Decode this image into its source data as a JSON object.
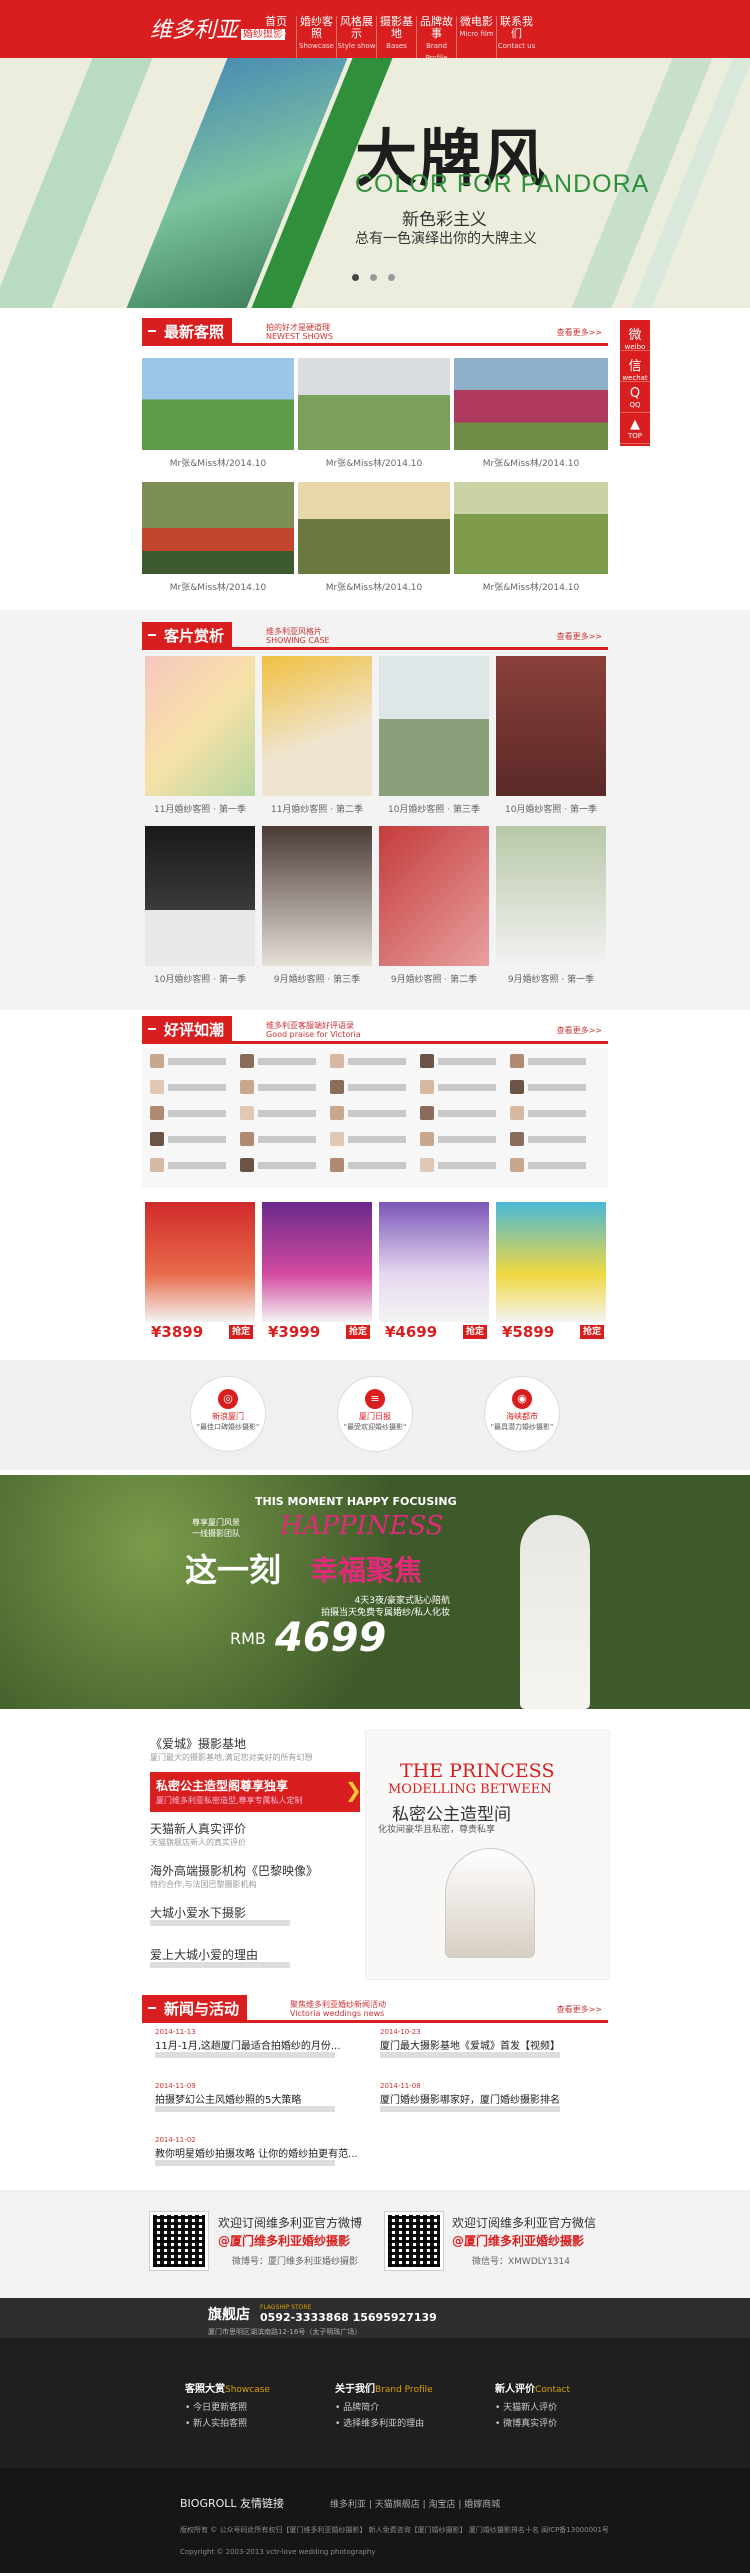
{
  "brand": {
    "logo": "维多利亚",
    "logo_tag": "婚纱摄影",
    "accent": "#d81e1e"
  },
  "nav": [
    {
      "zh": "首页",
      "en": "Home"
    },
    {
      "zh": "婚纱客照",
      "en": "Showcase"
    },
    {
      "zh": "风格展示",
      "en": "Style show"
    },
    {
      "zh": "摄影基地",
      "en": "Bases"
    },
    {
      "zh": "品牌故事",
      "en": "Brand Profile"
    },
    {
      "zh": "微电影",
      "en": "Micro film"
    },
    {
      "zh": "联系我们",
      "en": "Contact us"
    }
  ],
  "hero": {
    "title": "大牌风",
    "en": "COLOR FOR PANDORA",
    "sub1": "新色彩主义",
    "sub2": "总有一色演绎出你的大牌主义"
  },
  "sections": {
    "latest": {
      "title": "最新客照",
      "desc1": "拍的好才是硬道理",
      "desc2": "NEWEST SHOWS",
      "more": "查看更多>>"
    },
    "gallery": {
      "title": "客片赏析",
      "desc1": "维多利亚风格片",
      "desc2": "SHOWING CASE",
      "more": "查看更多>>"
    },
    "reviews": {
      "title": "好评如潮",
      "desc1": "维多利亚客服端好评语录",
      "desc2": "Good praise for Victoria",
      "more": "查看更多>>"
    },
    "news": {
      "title": "新闻与活动",
      "desc1": "聚焦维多利亚婚纱新闻活动",
      "desc2": "Victoria weddings news",
      "more": "查看更多>>"
    }
  },
  "latest_caps": [
    "Mr张&Miss林/2014.10",
    "Mr张&Miss林/2014.10",
    "Mr张&Miss林/2014.10",
    "Mr张&Miss林/2014.10",
    "Mr张&Miss林/2014.10",
    "Mr张&Miss林/2014.10"
  ],
  "gallery_caps": [
    "11月婚纱客照 · 第一季",
    "11月婚纱客照 · 第二季",
    "10月婚纱客照 · 第三季",
    "10月婚纱客照 · 第一季",
    "10月婚纱客照 · 第一季",
    "9月婚纱客照 · 第三季",
    "9月婚纱客照 · 第二季",
    "9月婚纱客照 · 第一季"
  ],
  "social": [
    {
      "g": "微",
      "t": "weibo"
    },
    {
      "g": "信",
      "t": "wechat"
    },
    {
      "g": "Q",
      "t": "QQ"
    },
    {
      "g": "▲",
      "t": "TOP"
    }
  ],
  "promos": [
    {
      "price": "¥3899",
      "btn": "抢定"
    },
    {
      "price": "¥3999",
      "btn": "抢定"
    },
    {
      "price": "¥4699",
      "btn": "抢定"
    },
    {
      "price": "¥5899",
      "btn": "抢定"
    }
  ],
  "circles": [
    {
      "t1": "新浪厦门",
      "t2": "\"最佳口碑婚纱摄影\""
    },
    {
      "t1": "厦门日报",
      "t2": "\"最受欢迎婚纱摄影\""
    },
    {
      "t1": "海峡都市",
      "t2": "\"最具潜力婚纱摄影\""
    }
  ],
  "banner": {
    "en": "THIS MOMENT HAPPY FOCUSING",
    "brand": "HAPPINESS",
    "t1": "这一刻",
    "t2": "幸福聚焦",
    "top1": "尊享厦门风景",
    "top2": "一线摄影团队",
    "d1": "4天3夜/豪家式贴心陪航",
    "d2": "拍摄当天免费专属婚纱/私人化妆",
    "price_label": "RMB",
    "price": "4699"
  },
  "left_list": [
    {
      "t": "《爱城》摄影基地",
      "s": "厦门最大的摄影基地,满足您对美好的所有幻想"
    },
    {
      "t": "私密公主造型阁尊享独享",
      "s": "厦门维多利亚私密造型,尊享专属私人定制"
    },
    {
      "t": "天猫新人真实评价",
      "s": "天猫旗舰店新人的真实评价"
    },
    {
      "t": "海外高端摄影机构《巴黎映像》",
      "s": "特约合作,与法国巴黎摄影机构"
    },
    {
      "t": "大城小爱水下摄影",
      "s": ""
    },
    {
      "t": "爱上大城小爱的理由",
      "s": ""
    }
  ],
  "princess": {
    "t1": "THE PRINCESS",
    "t2": "MODELLING BETWEEN",
    "t3": "私密公主造型间",
    "t4": "化妆间豪华且私密，尊贵私享"
  },
  "news": [
    {
      "d": "2014-11-13",
      "t": "11月-1月,这趟厦门最适合拍婚纱的月份..."
    },
    {
      "d": "2014-10-23",
      "t": "厦门最大摄影基地《爱城》首发【视频】"
    },
    {
      "d": "2014-11-09",
      "t": "拍摄梦幻公主风婚纱照的5大策略"
    },
    {
      "d": "2014-11-08",
      "t": "厦门婚纱摄影哪家好，厦门婚纱摄影排名"
    },
    {
      "d": "2014-11-02",
      "t": "教你明星婚纱拍摄攻略 让你的婚纱拍更有范..."
    }
  ],
  "follow": {
    "weibo_title": "欢迎订阅维多利亚官方微博",
    "weibo_name": "@厦门维多利亚婚纱摄影",
    "weibo_sub": "微博号：厦门维多利亚婚纱摄影",
    "wx_title": "欢迎订阅维多利亚官方微信",
    "wx_name": "@厦门维多利亚婚纱摄影",
    "wx_sub": "微信号：XMWDLY1314"
  },
  "flagship": {
    "t": "旗舰店",
    "en": "FLAGSHIP STORE",
    "phone": "0592-3333868  15695927139",
    "addr": "厦门市思明区湖滨南路12-16号（太子明珠广场）"
  },
  "footer_cols": [
    {
      "h": "客照大赏",
      "en": "Showcase",
      "items": [
        "今日更新客照",
        "新人实拍客照"
      ]
    },
    {
      "h": "关于我们",
      "en": "Brand Profile",
      "items": [
        "品牌简介",
        "选择维多利亚的理由"
      ]
    },
    {
      "h": "新人评价",
      "en": "Contact",
      "items": [
        "天猫新人评价",
        "微博真实评价"
      ]
    }
  ],
  "links": {
    "title": "BIOGROLL 友情链接",
    "items": "维多利亚 | 天猫旗舰店 | 淘宝店 | 婚嫁商城"
  },
  "copyright": {
    "l1": "版权所有 © 公众号码此所有权归【厦门维多利亚婚纱摄影】 新人免费咨询【厦门婚纱摄影】 厦门婚纱摄影排名十名 闽ICP备13000001号",
    "l2": "Copyright © 2003-2013 vctr-love wedding photography"
  }
}
